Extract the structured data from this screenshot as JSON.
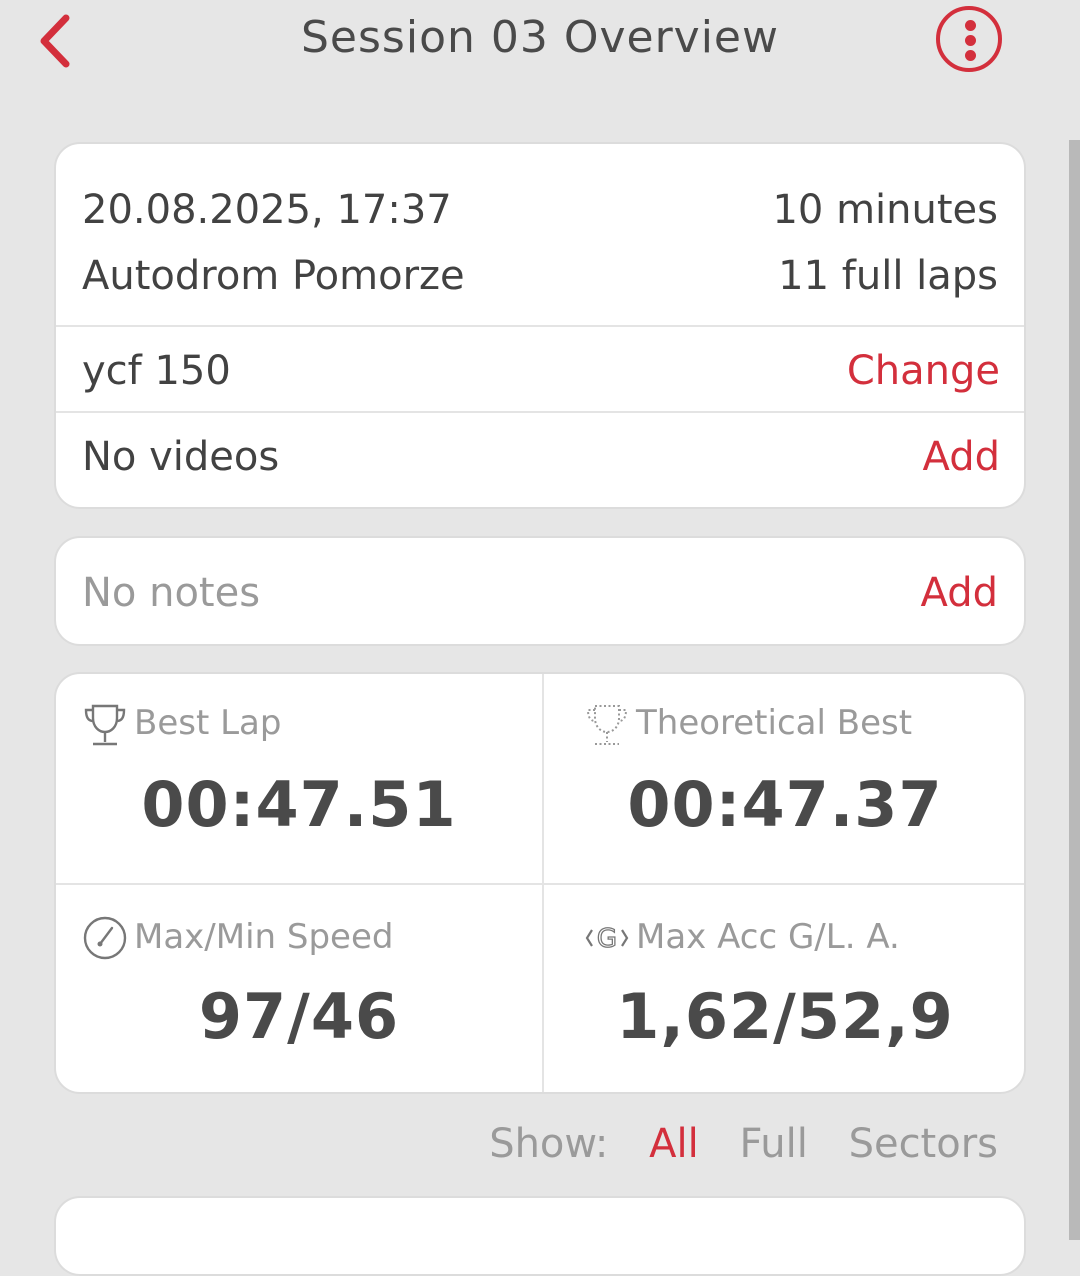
{
  "header": {
    "title": "Session 03 Overview",
    "back_icon": "chevron-left-icon",
    "menu_icon": "more-vertical-icon"
  },
  "session": {
    "datetime": "20.08.2025, 17:37",
    "duration": "10 minutes",
    "track": "Autodrom Pomorze",
    "laps": "11 full laps",
    "vehicle": "ycf 150",
    "vehicle_action": "Change",
    "videos": "No videos",
    "videos_action": "Add"
  },
  "notes": {
    "text": "No notes",
    "action": "Add"
  },
  "stats": {
    "best_lap_label": "Best Lap",
    "best_lap_value": "00:47.51",
    "theoretical_best_label": "Theoretical Best",
    "theoretical_best_value": "00:47.37",
    "speed_label": "Max/Min Speed",
    "speed_value": "97/46",
    "acc_label": "Max Acc G/L. A.",
    "acc_value": "1,62/52,9"
  },
  "filter": {
    "label": "Show:",
    "options": [
      "All",
      "Full",
      "Sectors"
    ],
    "selected": "All"
  },
  "colors": {
    "accent": "#d32f3c",
    "background": "#e6e6e6",
    "card": "#ffffff",
    "muted_text": "#9a9a9a"
  }
}
